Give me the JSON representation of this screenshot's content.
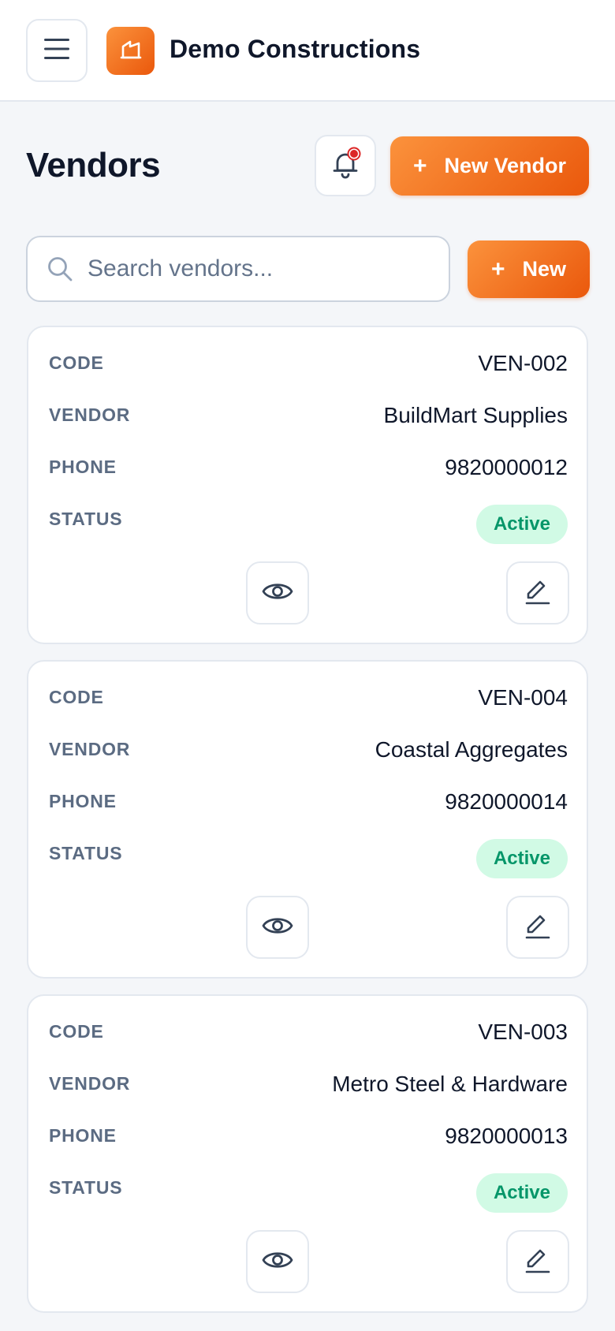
{
  "app": {
    "brand_name": "Demo Constructions",
    "accent_color": "#ea580c"
  },
  "header": {
    "title": "Vendors",
    "new_vendor_label": "New Vendor",
    "notification_badge_color": "#dc2626"
  },
  "search": {
    "placeholder": "Search vendors...",
    "new_label": "New"
  },
  "labels": {
    "code": "CODE",
    "vendor": "VENDOR",
    "phone": "PHONE",
    "status": "STATUS"
  },
  "vendors": [
    {
      "code": "VEN-002",
      "vendor": "BuildMart Supplies",
      "phone": "9820000012",
      "status": "Active"
    },
    {
      "code": "VEN-004",
      "vendor": "Coastal Aggregates",
      "phone": "9820000014",
      "status": "Active"
    },
    {
      "code": "VEN-003",
      "vendor": "Metro Steel & Hardware",
      "phone": "9820000013",
      "status": "Active"
    }
  ]
}
